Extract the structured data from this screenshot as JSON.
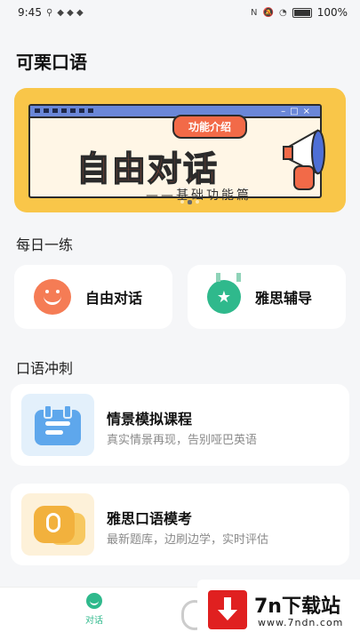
{
  "status_bar": {
    "time": "9:45",
    "battery": "100%"
  },
  "app": {
    "title": "可栗口语"
  },
  "banner": {
    "tag": "功能介绍",
    "headline": "自由对话",
    "subtitle": "——基础功能篇"
  },
  "daily": {
    "title": "每日一练",
    "items": [
      {
        "label": "自由对话",
        "icon": "chat-smile-icon"
      },
      {
        "label": "雅思辅导",
        "icon": "medal-star-icon"
      }
    ]
  },
  "sprint": {
    "title": "口语冲刺",
    "courses": [
      {
        "title": "情景模拟课程",
        "desc": "真实情景再现，告别哑巴英语",
        "icon": "calendar-icon"
      },
      {
        "title": "雅思口语模考",
        "desc": "最新题库，边刷边学，实时评估",
        "icon": "microphone-bubble-icon"
      }
    ]
  },
  "bottom_nav": {
    "tabs": [
      {
        "label": "对话",
        "active": true
      }
    ]
  },
  "watermark": {
    "title": "7n下载站",
    "url": "www.7ndn.com"
  },
  "colors": {
    "accent_green": "#2fb98c",
    "banner_yellow": "#f9c649",
    "banner_red": "#f26a48"
  }
}
